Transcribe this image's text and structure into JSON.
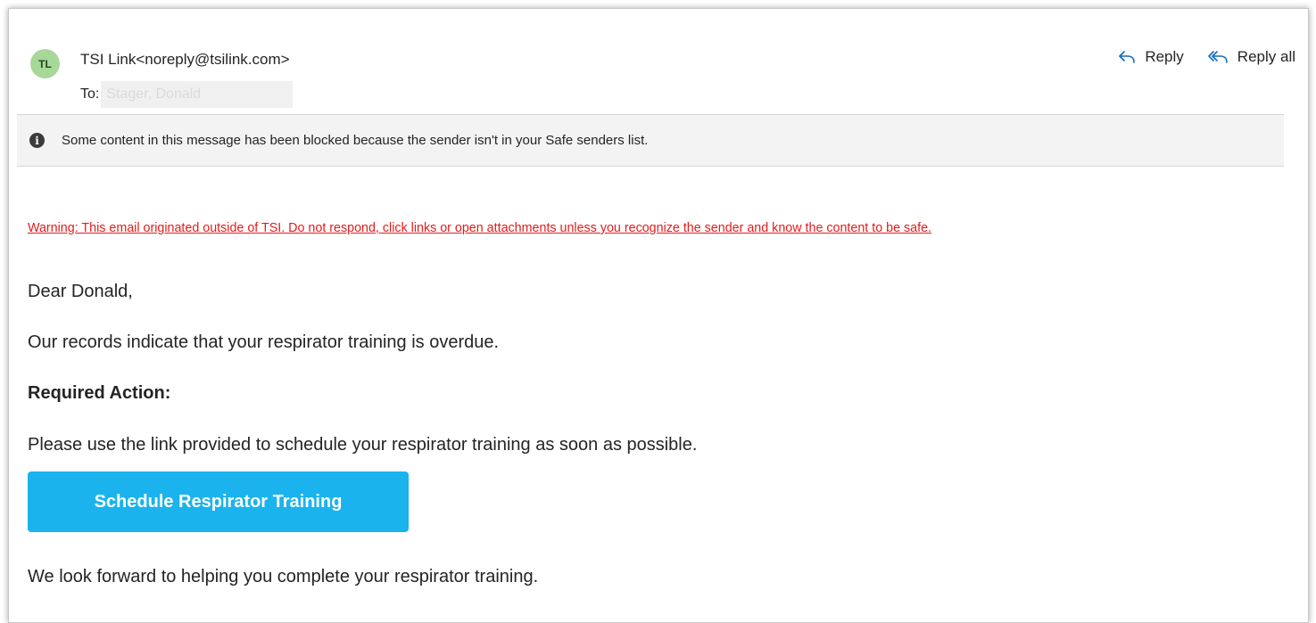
{
  "header": {
    "avatar_initials": "TL",
    "sender": "TSI Link<noreply@tsilink.com>",
    "to_label": "To:",
    "to_value": "Stager, Donald"
  },
  "actions": {
    "reply_label": "Reply",
    "reply_all_label": "Reply all"
  },
  "infobar": {
    "text": "Some content in this message has been blocked because the sender isn't in your Safe senders list."
  },
  "body": {
    "warning": "Warning: This email originated outside of TSI.  Do not respond, click links or open attachments unless you recognize the sender and know the content to be safe.",
    "greeting": "Dear Donald,",
    "line1": "Our records indicate that your respirator training is overdue.",
    "required_action_heading": "Required Action:",
    "line2": "Please use the link provided to schedule your respirator training as soon as possible.",
    "cta_label": "Schedule Respirator Training",
    "closing": "We look forward to helping you complete your respirator training."
  },
  "colors": {
    "accent_button": "#1ab3ee",
    "warning_red": "#e51b1b",
    "icon_blue": "#0f6cbd",
    "avatar_green": "#a8d79a"
  },
  "icons": [
    "info-icon",
    "reply-icon",
    "reply-all-icon"
  ]
}
